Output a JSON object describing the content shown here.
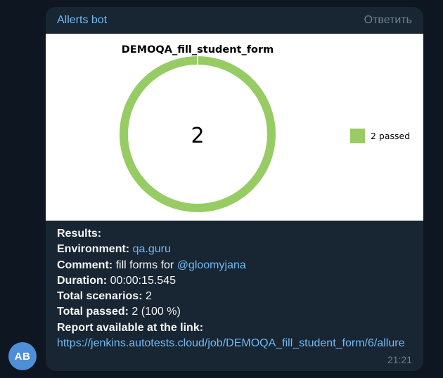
{
  "message": {
    "sender": "Allerts bot",
    "reply_label": "Ответить",
    "time": "21:21",
    "avatar_initials": "AB"
  },
  "chart_data": {
    "type": "pie",
    "title": "DEMOQA_fill_student_form",
    "center_label": "2",
    "slices": [
      {
        "label": "2 passed",
        "value": 2,
        "color": "#97cc64"
      }
    ],
    "legend": "right"
  },
  "results": {
    "heading": "Results:",
    "environment_label": "Environment:",
    "environment_value": "qa.guru",
    "comment_label": "Comment:",
    "comment_text": "fill forms for",
    "comment_mention": "@gloomyjana",
    "duration_label": "Duration:",
    "duration_value": "00:00:15.545",
    "total_scenarios_label": "Total scenarios:",
    "total_scenarios_value": "2",
    "total_passed_label": "Total passed:",
    "total_passed_value": "2 (100 %)",
    "report_label": "Report available at the link:",
    "report_url": "https://jenkins.autotests.cloud/job/DEMOQA_fill_student_form/6/allure"
  }
}
